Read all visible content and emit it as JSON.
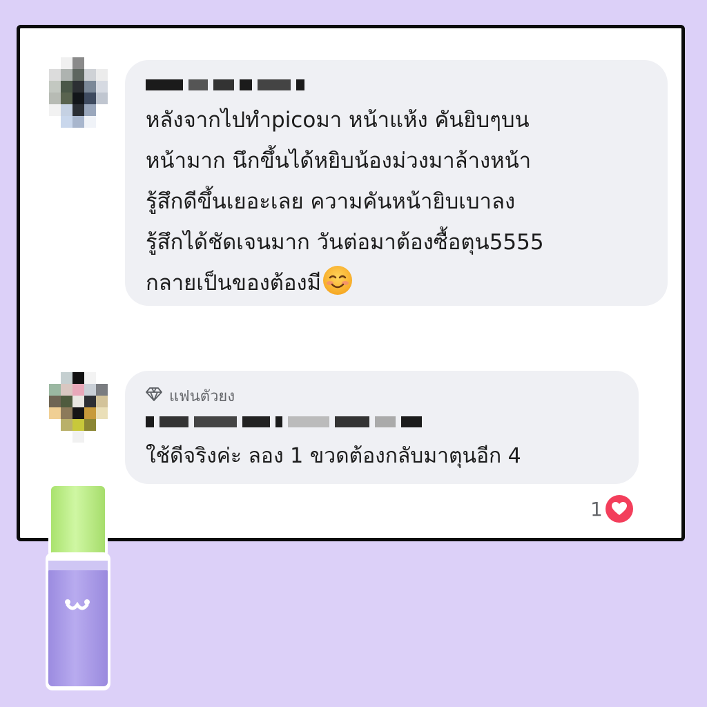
{
  "colors": {
    "page_background": "#dcd0f8",
    "card_background": "#ffffff",
    "card_border": "#0b0b0b",
    "bubble_background": "#eff0f4",
    "heart": "#f33e5b",
    "bottle_cap": "#bdf089",
    "bottle_body": "#ab9de6"
  },
  "comments": [
    {
      "avatar": "pixelated-avatar",
      "author": "redacted",
      "text": "หลังจากไปทำpicoมา  หน้าแห้ง คันยิบๆบน\nหน้ามาก  นึกขึ้นได้หยิบน้องม่วงมาล้างหน้า\nรู้สึกดีขึ้นเยอะเลย  ความคันหน้ายิบเบาลง\nรู้สึกได้ชัดเจนมาก  วันต่อมาต้องซื้อตุน5555\nกลายเป็นของต้องมี",
      "emoji": "smiling-face-emoji"
    },
    {
      "avatar": "pixelated-avatar",
      "badge_icon": "diamond-icon",
      "badge_label": "แฟนตัวยง",
      "author": "redacted",
      "text": "ใช้ดีจริงค่ะ ลอง 1 ขวดต้องกลับมาตุนอีก 4",
      "reaction_count": "1",
      "reaction_icon": "heart-icon"
    }
  ],
  "product": {
    "icon": "cat-mouth-logo-icon"
  }
}
